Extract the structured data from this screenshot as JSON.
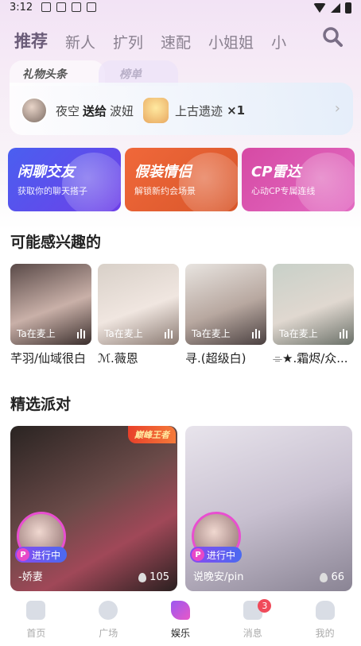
{
  "status_bar": {
    "time": "3:12"
  },
  "top_tabs": [
    {
      "label": "推荐",
      "active": true
    },
    {
      "label": "新人",
      "active": false
    },
    {
      "label": "扩列",
      "active": false
    },
    {
      "label": "速配",
      "active": false
    },
    {
      "label": "小姐姐",
      "active": false
    },
    {
      "label": "小",
      "active": false
    }
  ],
  "gift_card": {
    "tabs": [
      "礼物头条",
      "榜单"
    ],
    "sender": "夜空",
    "action": "送给",
    "receiver": "波妞",
    "gift_name": "上古遗迹",
    "gift_count": "×1"
  },
  "features": [
    {
      "title": "闲聊交友",
      "subtitle": "获取你的聊天搭子"
    },
    {
      "title": "假装情侣",
      "subtitle": "解锁新约会场景"
    },
    {
      "title": "CP雷达",
      "subtitle": "心动CP专属连线"
    }
  ],
  "interested": {
    "title": "可能感兴趣的",
    "people": [
      {
        "name": "芊羽/仙域很白",
        "badge": "Ta在麦上"
      },
      {
        "name": "ℳ.薇恩",
        "badge": "Ta在麦上"
      },
      {
        "name": "寻.(超级白)",
        "badge": "Ta在麦上"
      },
      {
        "name": "⌯★.霜烬/众...",
        "badge": "Ta在麦上"
      }
    ]
  },
  "parties": {
    "title": "精选派对",
    "rooms": [
      {
        "name": "-娇妻",
        "heat": "105",
        "status": "进行中",
        "tag": "巅峰王者"
      },
      {
        "name": "说晚安/pin",
        "heat": "66",
        "status": "进行中",
        "tag": ""
      }
    ]
  },
  "bottom_nav": [
    {
      "label": "首页",
      "active": false,
      "icon": "home-icon"
    },
    {
      "label": "广场",
      "active": false,
      "icon": "compass-icon"
    },
    {
      "label": "娱乐",
      "active": true,
      "icon": "entertainment-icon"
    },
    {
      "label": "消息",
      "active": false,
      "icon": "message-icon",
      "badge": "3"
    },
    {
      "label": "我的",
      "active": false,
      "icon": "profile-icon"
    }
  ],
  "colors": {
    "accent": "#e84fd0",
    "pk_gradient_start": "#8a4af0",
    "badge_red": "#f04a5a"
  }
}
